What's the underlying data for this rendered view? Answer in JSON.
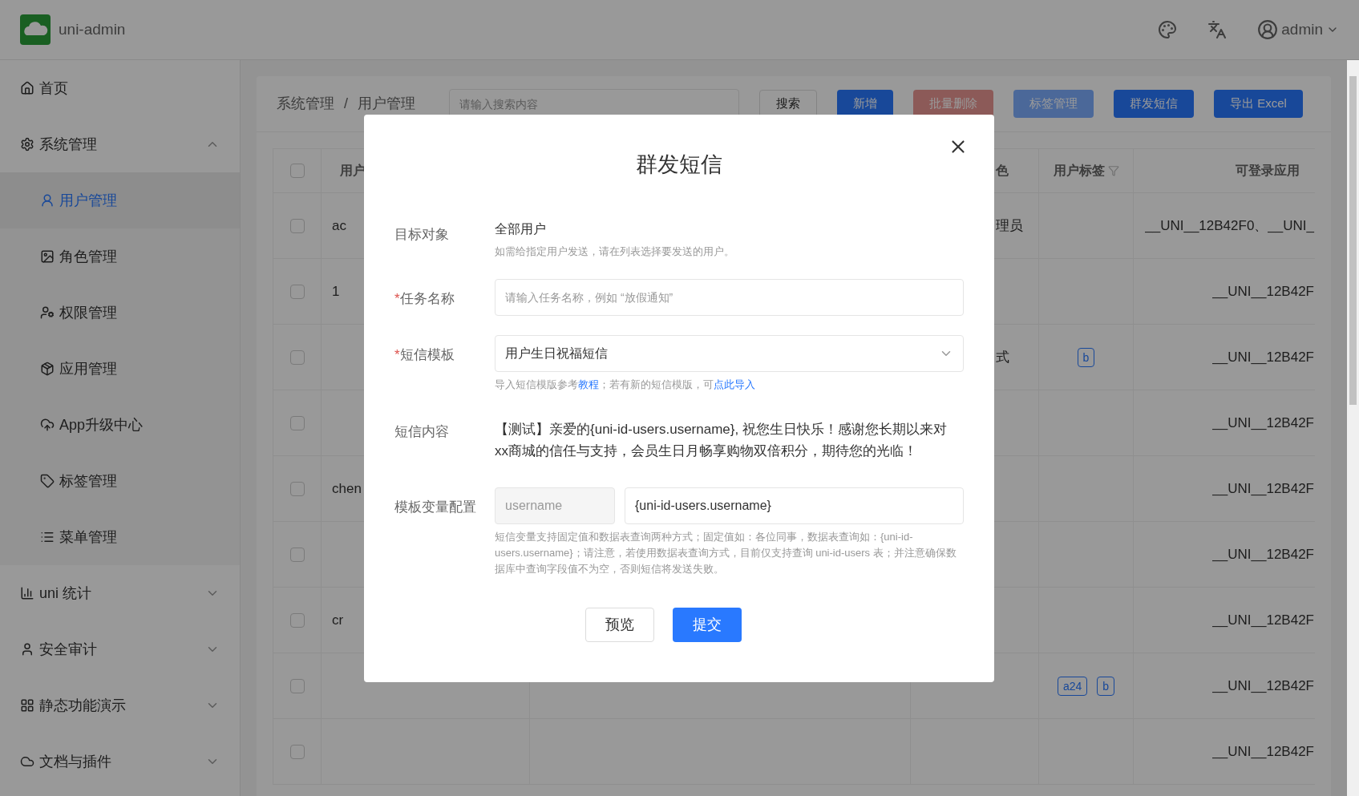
{
  "header": {
    "app_name": "uni-admin",
    "user_name": "admin"
  },
  "sidebar": {
    "items": [
      {
        "label": "首页",
        "selected": false
      },
      {
        "label": "系统管理",
        "expanded": true,
        "selected": false,
        "children": [
          {
            "label": "用户管理",
            "selected": true
          },
          {
            "label": "角色管理",
            "selected": false
          },
          {
            "label": "权限管理",
            "selected": false
          },
          {
            "label": "应用管理",
            "selected": false
          },
          {
            "label": "App升级中心",
            "selected": false
          },
          {
            "label": "标签管理",
            "selected": false
          },
          {
            "label": "菜单管理",
            "selected": false
          }
        ]
      },
      {
        "label": "uni 统计",
        "expanded": false,
        "selected": false
      },
      {
        "label": "安全审计",
        "expanded": false,
        "selected": false
      },
      {
        "label": "静态功能演示",
        "expanded": false,
        "selected": false
      },
      {
        "label": "文档与插件",
        "expanded": false,
        "selected": false
      }
    ]
  },
  "toolbar": {
    "breadcrumb": {
      "items": [
        "系统管理",
        "用户管理"
      ],
      "separator": "/"
    },
    "search": {
      "placeholder": "请输入搜索内容"
    },
    "buttons": [
      {
        "label": "搜索",
        "kind": "default",
        "disabled": false
      },
      {
        "label": "新增",
        "kind": "primary",
        "disabled": false
      },
      {
        "label": "批量删除",
        "kind": "danger",
        "disabled": true
      },
      {
        "label": "标签管理",
        "kind": "primary",
        "disabled": true
      },
      {
        "label": "群发短信",
        "kind": "primary",
        "disabled": false
      },
      {
        "label": "导出 Excel",
        "kind": "primary",
        "disabled": false
      }
    ]
  },
  "table": {
    "select_all": {
      "checked": false
    },
    "columns": [
      "用户",
      "色",
      "用户标签",
      "可登录应用"
    ],
    "rows": [
      {
        "checked": false,
        "user": "ac",
        "role": "理员",
        "tags": [],
        "apps": "__UNI__12B42F0、__UNI_"
      },
      {
        "checked": false,
        "user": "1",
        "tags": [],
        "apps": "__UNI__12B42F"
      },
      {
        "checked": false,
        "role": "式",
        "tags": [
          "b"
        ],
        "apps": "__UNI__12B42F"
      },
      {
        "checked": false,
        "tags": [],
        "apps": "__UNI__12B42F"
      },
      {
        "checked": false,
        "user": "chen",
        "tags": [],
        "apps": "__UNI__12B42F"
      },
      {
        "checked": false,
        "tags": [],
        "apps": "__UNI__12B42F"
      },
      {
        "checked": false,
        "user": "cr",
        "tags": [],
        "apps": "__UNI__12B42F"
      },
      {
        "checked": false,
        "tags": [
          "a24",
          "b"
        ],
        "apps": "__UNI__12B42F"
      },
      {
        "checked": false,
        "tags": [],
        "apps": "__UNI__12B42F"
      }
    ]
  },
  "dialog": {
    "title": "群发短信",
    "fields": [
      {
        "kind": "static",
        "label": "目标对象",
        "value": "全部用户",
        "hint": [
          {
            "text": "如需给指定用户发送，请在列表选择要发送的用户。",
            "link": false
          }
        ]
      },
      {
        "kind": "input",
        "label": "任务名称",
        "required_mark": "*",
        "placeholder": "请输入任务名称，例如 “放假通知”"
      },
      {
        "kind": "select",
        "label": "短信模板",
        "required_mark": "*",
        "value": "用户生日祝福短信",
        "hint": [
          {
            "text": "导入短信模版参考",
            "link": false
          },
          {
            "text": "教程",
            "link": true
          },
          {
            "text": "；若有新的短信模版，可",
            "link": false
          },
          {
            "text": "点此导入",
            "link": true
          }
        ]
      },
      {
        "kind": "text",
        "label": "短信内容",
        "value": "【测试】亲爱的{uni-id-users.username}, 祝您生日快乐！感谢您长期以来对xx商城的信任与支持，会员生日月畅享购物双倍积分，期待您的光临！"
      },
      {
        "kind": "variables",
        "label": "模板变量配置",
        "name": "username",
        "value": "{uni-id-users.username}",
        "hint": [
          {
            "text": "短信变量支持固定值和数据表查询两种方式；固定值如：各位同事，数据表查询如：{uni-id-users.username}；请注意，若使用数据表查询方式，目前仅支持查询 uni-id-users 表；并注意确保数据库中查询字段值不为空，否则短信将发送失败。",
            "link": false
          }
        ]
      }
    ],
    "buttons": [
      {
        "label": "预览",
        "kind": "default"
      },
      {
        "label": "提交",
        "kind": "primary"
      }
    ]
  }
}
